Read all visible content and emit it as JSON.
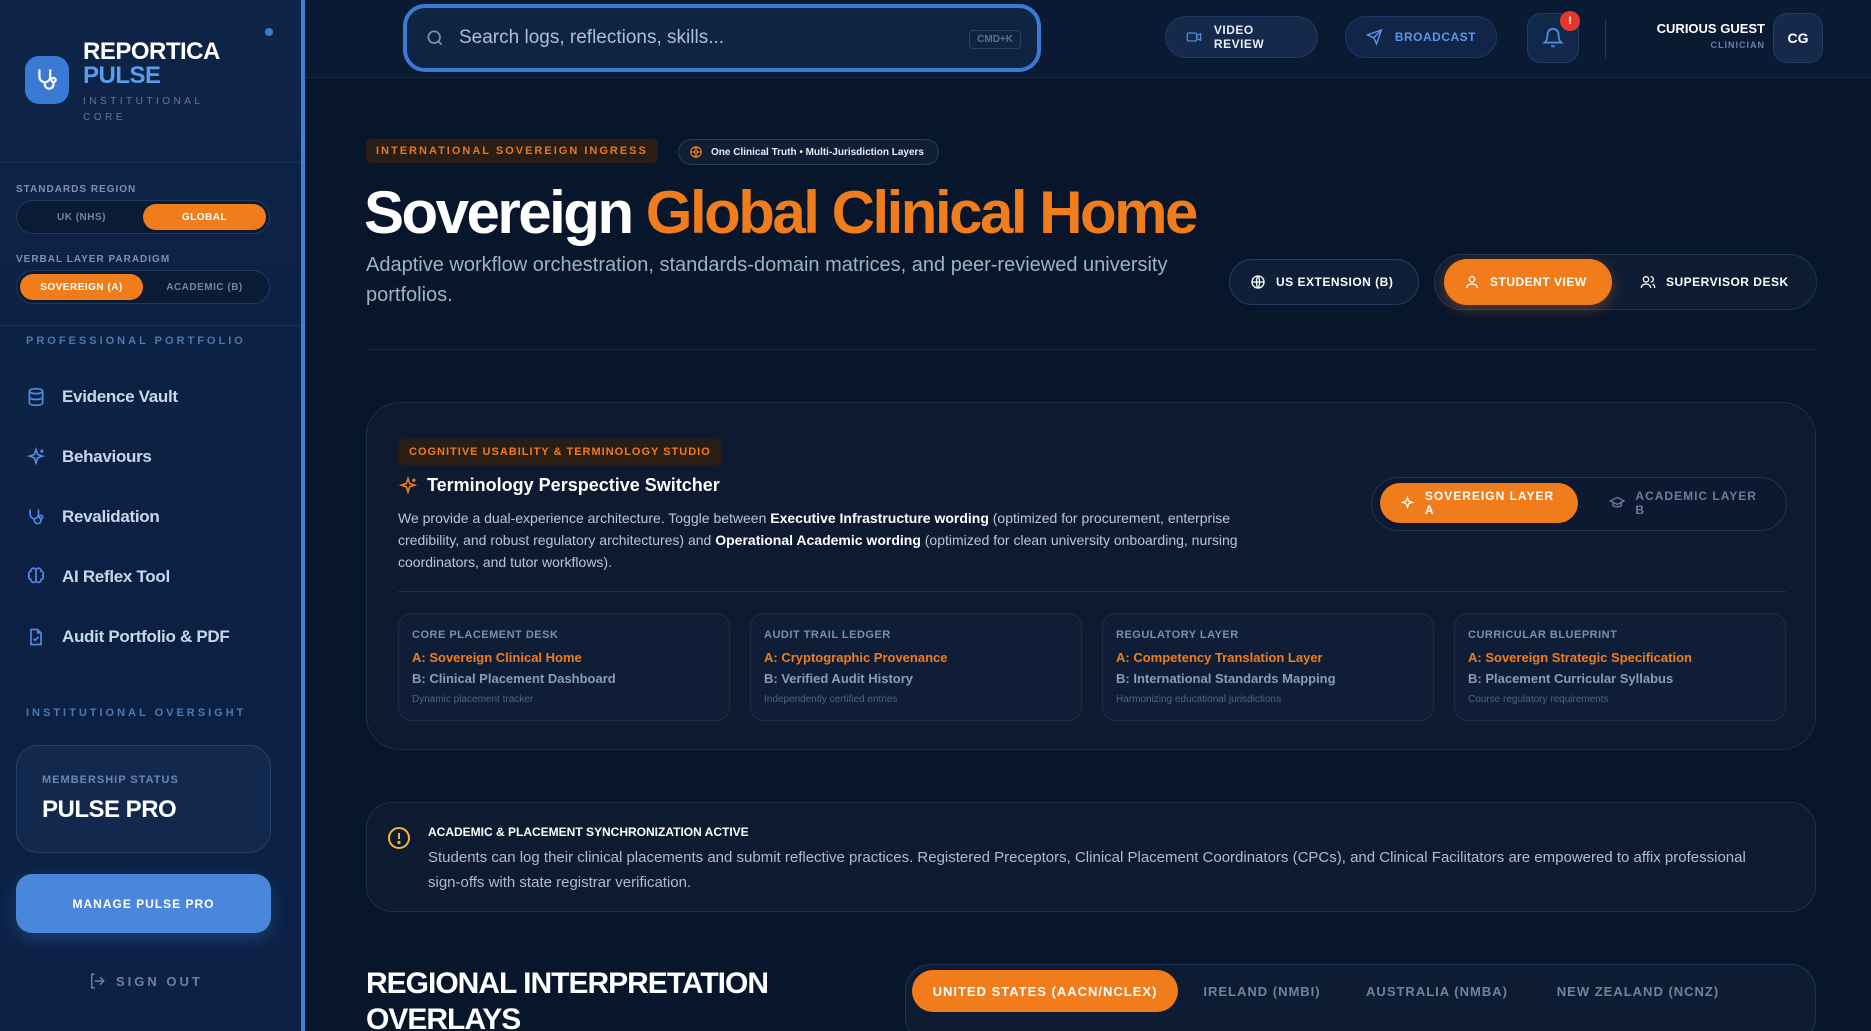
{
  "brand": {
    "title": "REPORTICA",
    "title2": "PULSE",
    "subtitle": "INSTITUTIONAL CORE"
  },
  "sidebar": {
    "standards_label": "STANDARDS REGION",
    "standards_options": [
      "UK (NHS)",
      "GLOBAL"
    ],
    "standards_selected": "GLOBAL",
    "verbal_label": "VERBAL LAYER PARADIGM",
    "verbal_options": [
      "SOVEREIGN (A)",
      "ACADEMIC (B)"
    ],
    "verbal_selected": "SOVEREIGN (A)",
    "section_portfolio": "PROFESSIONAL PORTFOLIO",
    "items": [
      {
        "label": "Evidence Vault",
        "icon": "database-icon"
      },
      {
        "label": "Behaviours",
        "icon": "sparkle-icon"
      },
      {
        "label": "Revalidation",
        "icon": "stethoscope-icon"
      },
      {
        "label": "AI Reflex Tool",
        "icon": "brain-icon"
      },
      {
        "label": "Audit Portfolio & PDF",
        "icon": "file-icon"
      }
    ],
    "section_oversight": "INSTITUTIONAL OVERSIGHT",
    "membership_label": "MEMBERSHIP STATUS",
    "membership_value": "PULSE PRO",
    "manage_label": "MANAGE PULSE PRO",
    "signout_label": "SIGN OUT"
  },
  "topbar": {
    "search_placeholder": "Search logs, reflections, skills...",
    "search_shortcut": "CMD+K",
    "video_review": "VIDEO REVIEW",
    "broadcast": "BROADCAST",
    "notification_badge": "!",
    "user_name": "CURIOUS GUEST",
    "user_role": "CLINICIAN",
    "user_initials": "CG"
  },
  "hero": {
    "tag": "INTERNATIONAL SOVEREIGN INGRESS",
    "pill": "One Clinical Truth • Multi-Jurisdiction Layers",
    "title_plain": "Sovereign ",
    "title_accent": "Global Clinical Home",
    "subtitle": "Adaptive workflow orchestration, standards-domain matrices, and peer-reviewed university portfolios.",
    "us_extension": "US EXTENSION (B)",
    "student_view": "STUDENT VIEW",
    "supervisor_desk": "SUPERVISOR DESK"
  },
  "studio": {
    "tag": "COGNITIVE USABILITY & TERMINOLOGY STUDIO",
    "title": "Terminology Perspective Switcher",
    "desc_1": "We provide a dual-experience architecture. Toggle between ",
    "desc_b1": "Executive Infrastructure wording",
    "desc_2": " (optimized for procurement, enterprise credibility, and robust regulatory architectures) and ",
    "desc_b2": "Operational Academic wording",
    "desc_3": " (optimized for clean university onboarding, nursing coordinators, and tutor workflows).",
    "layer_a": "SOVEREIGN LAYER A",
    "layer_b": "ACADEMIC LAYER B",
    "cards": [
      {
        "heading": "CORE PLACEMENT DESK",
        "a": "A: Sovereign Clinical Home",
        "b": "B: Clinical Placement Dashboard",
        "note": "Dynamic placement tracker"
      },
      {
        "heading": "AUDIT TRAIL LEDGER",
        "a": "A: Cryptographic Provenance",
        "b": "B: Verified Audit History",
        "note": "Independently certified entries"
      },
      {
        "heading": "REGULATORY LAYER",
        "a": "A: Competency Translation Layer",
        "b": "B: International Standards Mapping",
        "note": "Harmonizing educational jurisdictions"
      },
      {
        "heading": "CURRICULAR BLUEPRINT",
        "a": "A: Sovereign Strategic Specification",
        "b": "B: Placement Curricular Syllabus",
        "note": "Course regulatory requirements"
      }
    ]
  },
  "sync": {
    "title": "ACADEMIC & PLACEMENT SYNCHRONIZATION ACTIVE",
    "body": "Students can log their clinical placements and submit reflective practices. Registered Preceptors, Clinical Placement Coordinators (CPCs), and Clinical Facilitators are empowered to affix professional sign-offs with state registrar verification."
  },
  "regional": {
    "title": "REGIONAL INTERPRETATION OVERLAYS",
    "tabs": [
      "UNITED STATES (AACN/NCLEX)",
      "IRELAND (NMBI)",
      "AUSTRALIA (NMBA)",
      "NEW ZEALAND (NCNZ)"
    ],
    "selected": "UNITED STATES (AACN/NCLEX)"
  }
}
